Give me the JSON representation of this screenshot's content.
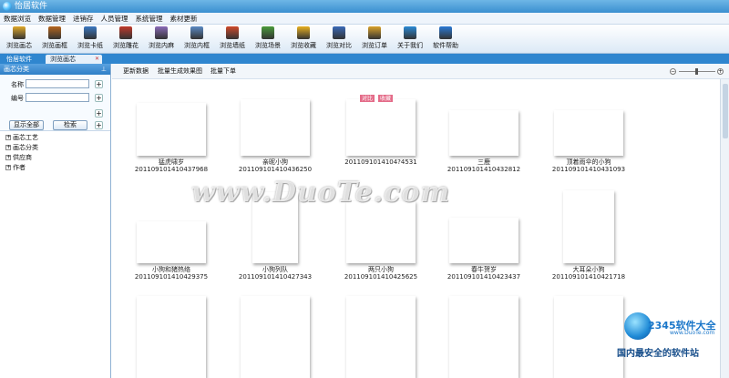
{
  "window": {
    "title": "怡居软件"
  },
  "menu": [
    "数据浏览",
    "数据管理",
    "进销存",
    "人员管理",
    "系统管理",
    "素材更新"
  ],
  "toolbar": [
    {
      "label": "浏览画芯",
      "icon": "painting-core-icon",
      "color": "#e0a92a"
    },
    {
      "label": "浏览画框",
      "icon": "frame-icon",
      "color": "#b5651d"
    },
    {
      "label": "浏览卡纸",
      "icon": "cardboard-icon",
      "color": "#3a78c2"
    },
    {
      "label": "浏览雕花",
      "icon": "carving-icon",
      "color": "#c0392b"
    },
    {
      "label": "浏览内麻",
      "icon": "linen-icon",
      "color": "#8a6bb8"
    },
    {
      "label": "浏览内框",
      "icon": "inner-frame-icon",
      "color": "#5a8ac4"
    },
    {
      "label": "浏览墙纸",
      "icon": "house-icon",
      "color": "#d04a2a"
    },
    {
      "label": "浏览场景",
      "icon": "scene-icon",
      "color": "#4a9a3a"
    },
    {
      "label": "浏览收藏",
      "icon": "favorite-icon",
      "color": "#e8b020"
    },
    {
      "label": "浏览对比",
      "icon": "compare-icon",
      "color": "#3a6ab8"
    },
    {
      "label": "浏览订单",
      "icon": "order-icon",
      "color": "#d9a12a"
    },
    {
      "label": "关于我们",
      "icon": "about-icon",
      "color": "#2a8ad6"
    },
    {
      "label": "软件帮助",
      "icon": "help-icon",
      "color": "#2a7ad6"
    }
  ],
  "tabs": [
    {
      "label": "怡居软件"
    },
    {
      "label": "浏览画芯"
    }
  ],
  "sidebar": {
    "header": "画芯分类",
    "name_label": "名称",
    "code_label": "编号",
    "show_all": "显示全部",
    "search": "检索",
    "tree": [
      "画芯工艺",
      "画芯分类",
      "供应商",
      "作者"
    ]
  },
  "content_toolbar": {
    "refresh": "更新数据",
    "batch": "批量生成效果图",
    "batch_order": "批量下单"
  },
  "overlay_tags": [
    "对比",
    "收藏"
  ],
  "watermark": "www.DuoTe.com",
  "logo": {
    "brand": "2345软件大全",
    "site": "www.DuoTe.com",
    "slogan": "国内最安全的软件站"
  },
  "items": [
    {
      "title": "猛虎啸岁",
      "code": "20110910141043​7968",
      "style": "tiger",
      "row": 0,
      "col": 0
    },
    {
      "title": "亲昵小狗",
      "code": "201109101410436250",
      "style": "dogs-dark",
      "row": 0,
      "col": 1
    },
    {
      "title": "",
      "code": "2011091014104?4531",
      "style": "dogs-red",
      "row": 0,
      "col": 2
    },
    {
      "title": "三鹿",
      "code": "201109101410432812",
      "style": "dogs-field",
      "row": 0,
      "col": 3
    },
    {
      "title": "顶着雨伞的小狗",
      "code": "201109101410431093",
      "style": "umbrella",
      "row": 0,
      "col": 4
    },
    {
      "title": "小狗和猪热络",
      "code": "201109101410429375",
      "style": "lab",
      "row": 1,
      "col": 0
    },
    {
      "title": "小狗列队",
      "code": "201109101410427343",
      "style": "two-dogs",
      "row": 1,
      "col": 1
    },
    {
      "title": "两只小狗",
      "code": "201109101410425625",
      "style": "pup-grass",
      "row": 1,
      "col": 2
    },
    {
      "title": "春牛贺岁",
      "code": "201109101410423437",
      "style": "cows",
      "row": 1,
      "col": 3
    },
    {
      "title": "大耳朵小狗",
      "code": "201109101410421718",
      "style": "basset",
      "row": 1,
      "col": 4
    },
    {
      "title": "",
      "code": "",
      "style": "ink",
      "row": 2,
      "col": 0
    },
    {
      "title": "",
      "code": "",
      "style": "ink2",
      "row": 2,
      "col": 1
    },
    {
      "title": "",
      "code": "",
      "style": "ink3",
      "row": 2,
      "col": 2
    },
    {
      "title": "",
      "code": "",
      "style": "ink4",
      "row": 2,
      "col": 3
    },
    {
      "title": "",
      "code": "",
      "style": "ink5",
      "row": 2,
      "col": 4
    }
  ]
}
